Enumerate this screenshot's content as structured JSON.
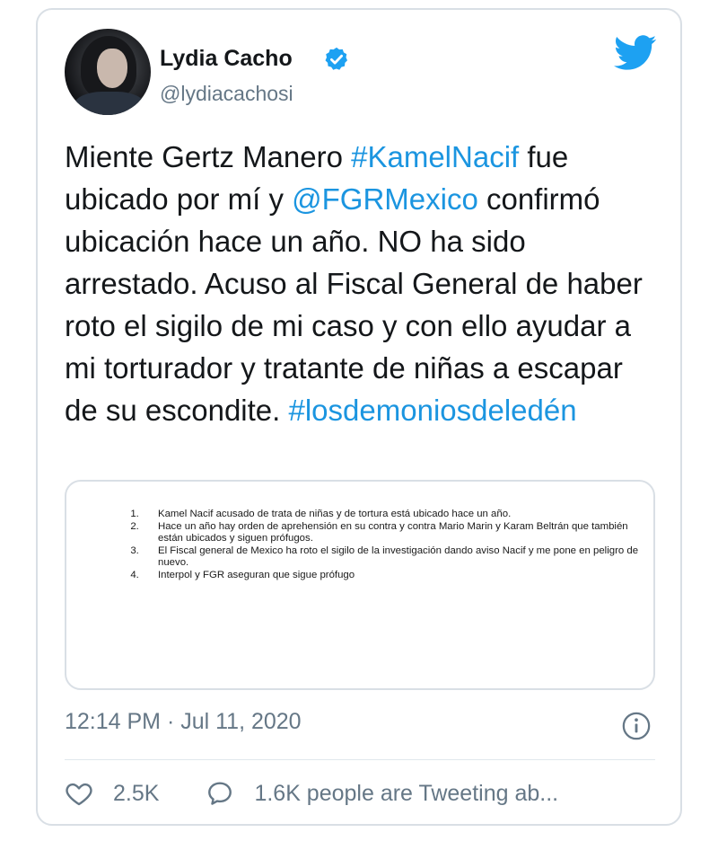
{
  "author": {
    "name": "Lydia Cacho",
    "handle": "@lydiacachosi",
    "verified": true
  },
  "tweet": {
    "segments": [
      {
        "text": "Miente Gertz Manero ",
        "type": "text"
      },
      {
        "text": "#KamelNacif",
        "type": "hashtag"
      },
      {
        "text": " fue ubicado por mí y  ",
        "type": "text"
      },
      {
        "text": "@FGRMexico",
        "type": "mention"
      },
      {
        "text": " confirmó ubicación hace un año. NO ha sido arrestado. Acuso al Fiscal General de haber roto el sigilo de mi caso y con ello ayudar a mi torturador y tratante de niñas a escapar de su escondite. ",
        "type": "text"
      },
      {
        "text": "#losdemoniosdeledén",
        "type": "hashtag"
      }
    ]
  },
  "attached_image": {
    "list": [
      "Kamel Nacif acusado de trata de niñas y de tortura está ubicado hace un año.",
      "Hace un año hay orden de aprehensión en su contra y contra Mario Marin y Karam Beltrán que también están ubicados y siguen prófugos.",
      "El Fiscal general de Mexico ha roto el sigilo de la investigación dando aviso Nacif y me pone en peligro de nuevo.",
      "Interpol y FGR aseguran que sigue prófugo"
    ]
  },
  "meta": {
    "timestamp": "12:14 PM · Jul 11, 2020"
  },
  "actions": {
    "likes": "2.5K",
    "tweeting": "1.6K people are Tweeting ab..."
  },
  "colors": {
    "link": "#1b95e0",
    "verified": "#1da1f2",
    "muted": "#657786",
    "border": "#d9dfe5"
  },
  "icons": [
    "twitter-bird-icon",
    "verified-badge-icon",
    "info-icon",
    "heart-icon",
    "comment-bubble-icon"
  ]
}
